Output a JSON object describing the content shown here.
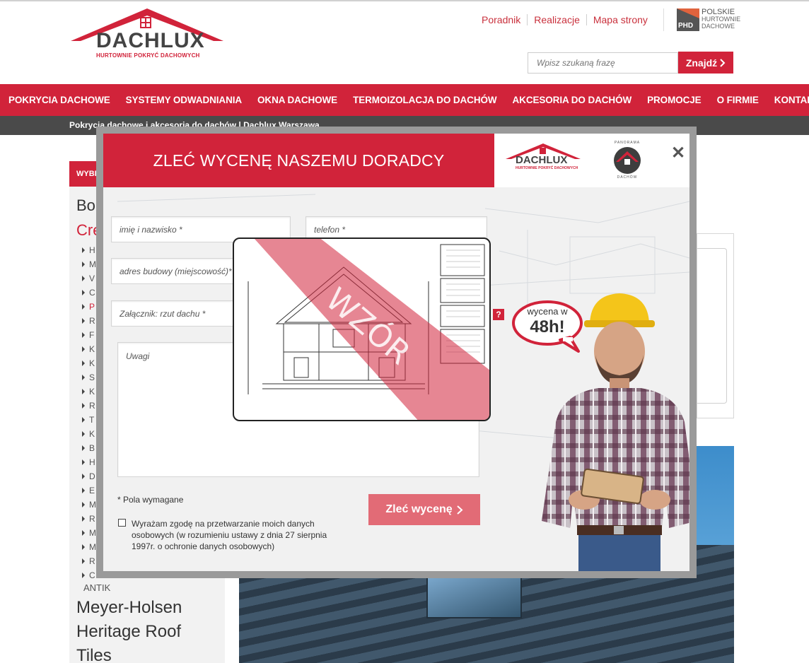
{
  "header": {
    "logo_word": "DACHLUX",
    "logo_tagline": "HURTOWNIE POKRYĆ DACHOWYCH",
    "top_links": [
      "Poradnik",
      "Realizacje",
      "Mapa strony"
    ],
    "phd_badge": {
      "abbr": "PHD",
      "line1": "POLSKIE",
      "line2": "HURTOWNIE",
      "line3": "DACHOWE"
    },
    "search": {
      "placeholder": "Wpisz szukaną frazę",
      "button_label": "Znajdź"
    }
  },
  "nav": {
    "items": [
      "POKRYCIA DACHOWE",
      "SYSTEMY ODWADNIANIA",
      "OKNA DACHOWE",
      "TERMOIZOLACJA DO DACHÓW",
      "AKCESORIA DO DACHÓW",
      "PROMOCJE",
      "O FIRMIE",
      "KONTAKT"
    ]
  },
  "subbar": {
    "text": "Pokrycia dachowe i akcesoria do dachów | Dachlux Warszawa"
  },
  "sidebar": {
    "header": "WYBI",
    "heading1": "Bo",
    "heading2": "Cre",
    "items": [
      "H",
      "M",
      "V",
      "C",
      "P",
      "R",
      "F",
      "K",
      "K",
      "S",
      "K",
      "R",
      "T",
      "K",
      "B",
      "H",
      "D",
      "E",
      "M",
      "R",
      "M",
      "M",
      "R",
      "C"
    ],
    "antik": "ANTIK",
    "lower": [
      "Meyer-Holsen",
      "Heritage Roof",
      "Tiles"
    ]
  },
  "modal": {
    "title": "ZLEĆ WYCENĘ NASZEMU DORADCY",
    "logo_word": "DACHLUX",
    "logo_tagline": "HURTOWNIE POKRYĆ DACHOWYCH",
    "panorama_top": "PANORAMA",
    "panorama_bottom": "DACHÓW",
    "close": "✕",
    "fields": {
      "name": "imię i nazwisko *",
      "phone": "telefon *",
      "city": "adres budowy (miejscowość)*",
      "attachment": "Załącznik: rzut dachu *",
      "notes": "Uwagi"
    },
    "help": "?",
    "sample_watermark": "WZÓR",
    "required_note": "* Pola wymagane",
    "submit_label": "Zleć wycenę",
    "consent": "Wyrażam zgodę na przetwarzanie moich danych osobowych (w rozumieniu ustawy z dnia 27 sierpnia 1997r. o ochronie danych osobowych)",
    "bubble_line1": "wycena w",
    "bubble_line2": "48h!"
  },
  "colors": {
    "brand_red": "#d1233a",
    "dark_bar": "#4a4a4a",
    "submit_pink": "#e26b76"
  },
  "icons": {
    "search_arrow": "chevron-right-icon",
    "submit_arrow": "chevron-right-icon",
    "close": "close-icon"
  }
}
